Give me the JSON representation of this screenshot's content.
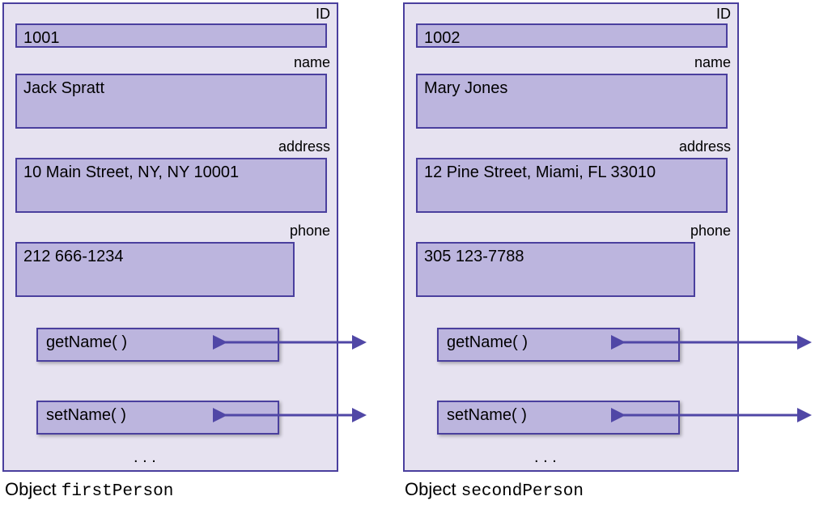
{
  "labels": {
    "id": "ID",
    "name": "name",
    "address": "address",
    "phone": "phone",
    "ellipsis": ". . .",
    "objectPrefix": "Object"
  },
  "methods": {
    "getName": "getName( )",
    "setName": "setName( )"
  },
  "objects": [
    {
      "varName": "firstPerson",
      "id": "1001",
      "name": "Jack Spratt",
      "address": "10 Main Street, NY, NY 10001",
      "phone": "212 666-1234"
    },
    {
      "varName": "secondPerson",
      "id": "1002",
      "name": "Mary Jones",
      "address": "12 Pine Street, Miami, FL 33010",
      "phone": "305 123-7788"
    }
  ]
}
